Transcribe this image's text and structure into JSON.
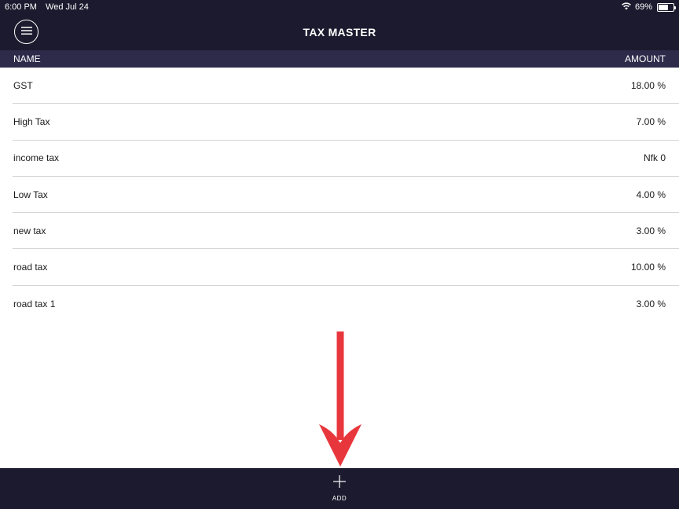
{
  "status_bar": {
    "time": "6:00 PM",
    "date": "Wed Jul 24",
    "battery": "69%",
    "battery_level": 0.69,
    "icons": [
      "wifi-icon",
      "battery-icon"
    ]
  },
  "nav": {
    "title": "TAX MASTER",
    "menu_icon": "hamburger-menu-icon"
  },
  "table": {
    "columns": {
      "name": "NAME",
      "amount": "AMOUNT"
    },
    "rows": [
      {
        "name": "GST",
        "amount": "18.00 %"
      },
      {
        "name": "High Tax",
        "amount": "7.00 %"
      },
      {
        "name": "income tax",
        "amount": "Nfk 0"
      },
      {
        "name": "Low Tax",
        "amount": "4.00 %"
      },
      {
        "name": "new tax",
        "amount": "3.00 %"
      },
      {
        "name": "road tax",
        "amount": "10.00 %"
      },
      {
        "name": "road tax 1",
        "amount": "3.00 %"
      }
    ]
  },
  "bottom_bar": {
    "add_label": "ADD",
    "add_icon": "plus-icon"
  },
  "colors": {
    "bar_background": "#1c1a2e",
    "header_background": "#2e2a4a",
    "annotation_arrow": "#e8373c"
  }
}
